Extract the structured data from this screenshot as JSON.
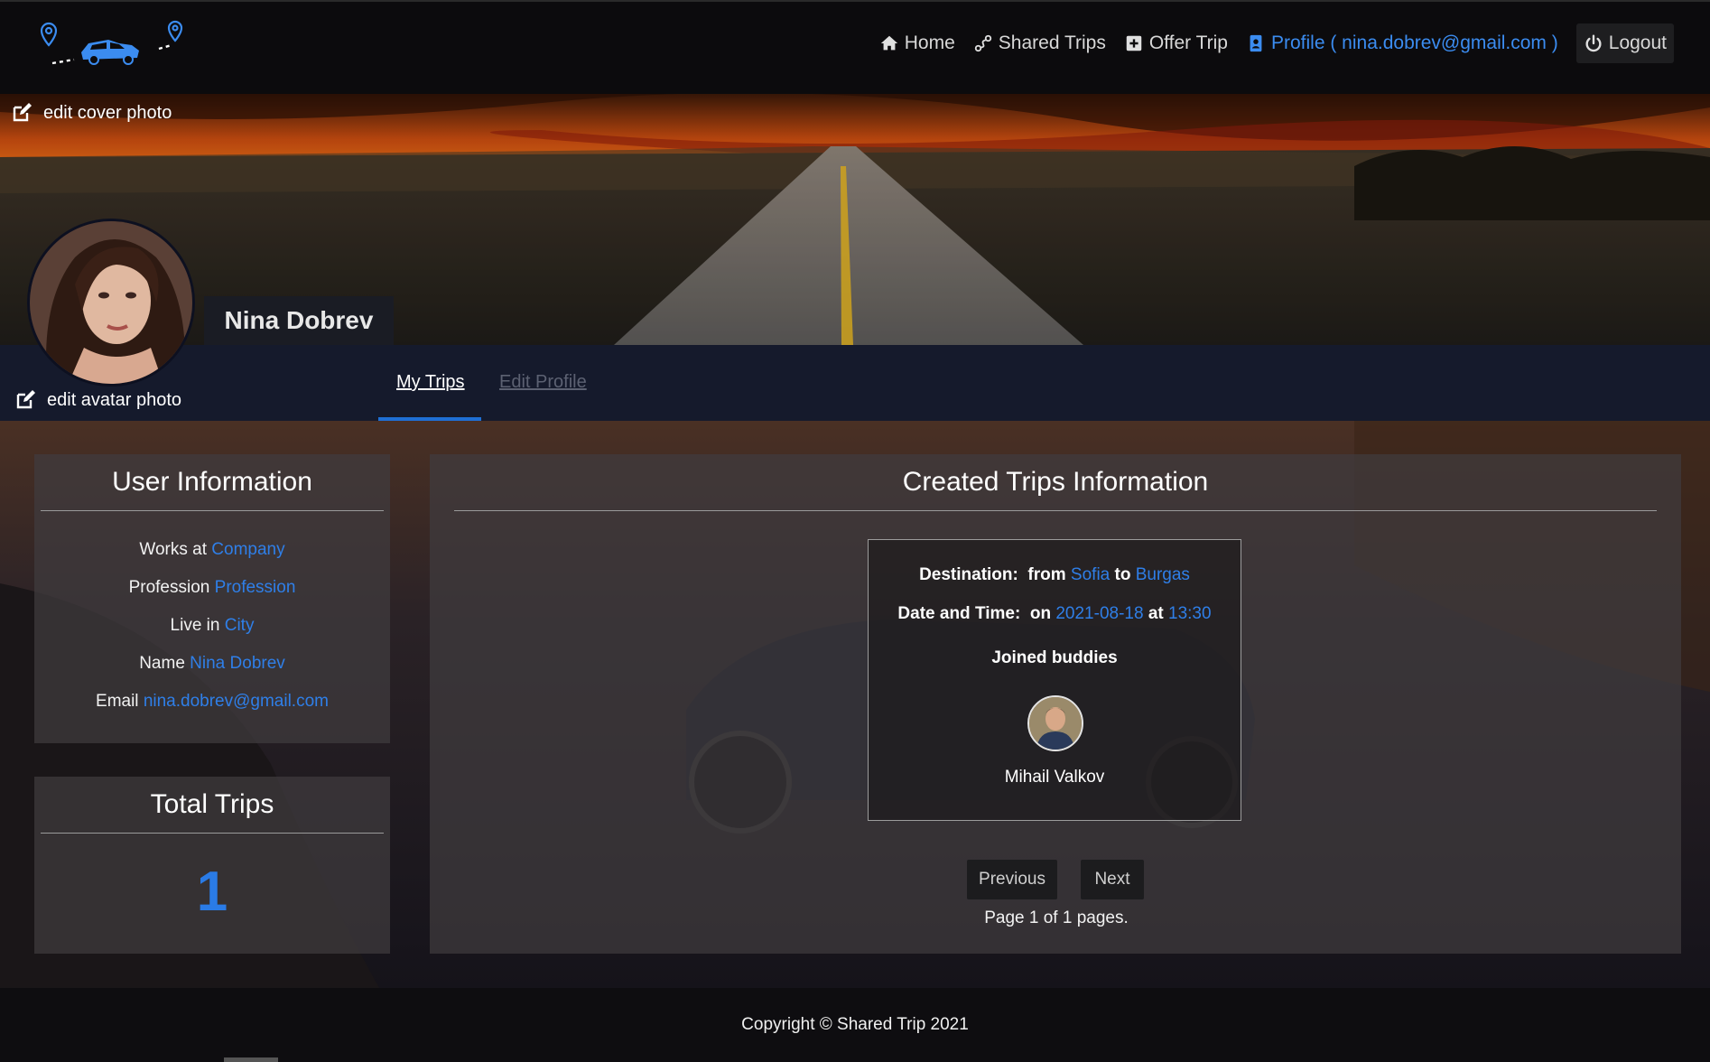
{
  "nav": {
    "home": "Home",
    "shared_trips": "Shared Trips",
    "offer_trip": "Offer Trip",
    "profile": "Profile ( nina.dobrev@gmail.com )",
    "logout": "Logout"
  },
  "cover": {
    "edit_cover_label": "edit cover photo"
  },
  "profile": {
    "name": "Nina Dobrev",
    "edit_avatar_label": "edit avatar photo"
  },
  "tabs": {
    "my_trips": "My Trips",
    "edit_profile": "Edit Profile"
  },
  "user_info": {
    "title": "User Information",
    "rows": [
      {
        "label": "Works at",
        "value": "Company"
      },
      {
        "label": "Profession",
        "value": "Profession"
      },
      {
        "label": "Live in",
        "value": "City"
      },
      {
        "label": "Name",
        "value": "Nina Dobrev"
      },
      {
        "label": "Email",
        "value": "nina.dobrev@gmail.com"
      }
    ]
  },
  "total_trips": {
    "title": "Total Trips",
    "count": "1"
  },
  "created_trips": {
    "title": "Created Trips Information",
    "trip": {
      "destination_label": "Destination:",
      "from_word": "from",
      "from": "Sofia",
      "to_word": "to",
      "to": "Burgas",
      "datetime_label": "Date and Time:",
      "on_word": "on",
      "date": "2021-08-18",
      "at_word": "at",
      "time": "13:30",
      "buddies_label": "Joined buddies",
      "buddy_name": "Mihail Valkov"
    },
    "previous": "Previous",
    "next": "Next",
    "page_info": "Page 1 of 1 pages."
  },
  "footer": {
    "copyright": "Copyright © Shared Trip 2021"
  },
  "colors": {
    "accent": "#2f7fe8",
    "navbar": "#0c0b0d",
    "tabbar": "#151a2c"
  }
}
